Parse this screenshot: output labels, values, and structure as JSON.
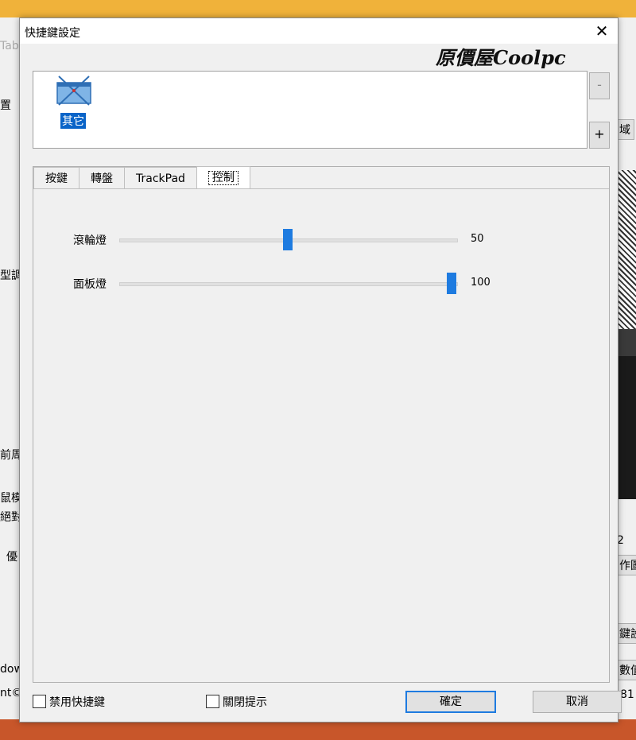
{
  "background_app": {
    "title_fragment": "Tab",
    "left_fragments": [
      "置",
      "型調",
      "前周",
      "鼠模",
      "絕對",
      "優",
      "dow",
      "nt©"
    ],
    "right_fragments": [
      "域",
      "2",
      "作圖",
      "鍵設定",
      "數值",
      "81"
    ]
  },
  "dialog": {
    "title": "快捷鍵設定",
    "close_glyph": "✕",
    "logo": "原價屋Coolpc",
    "app_icon_label": "其它",
    "remove_button": "-",
    "add_button": "+",
    "tabs": [
      {
        "label": "按鍵",
        "active": false
      },
      {
        "label": "轉盤",
        "active": false
      },
      {
        "label": "TrackPad",
        "active": false
      },
      {
        "label": "控制",
        "active": true
      }
    ],
    "sliders": [
      {
        "label": "滾輪燈",
        "value": "50",
        "percent": 50
      },
      {
        "label": "面板燈",
        "value": "100",
        "percent": 100
      }
    ],
    "disable_shortcuts_label": "禁用快捷鍵",
    "close_tips_label": "關閉提示",
    "ok_button": "確定",
    "cancel_button": "取消"
  },
  "colors": {
    "accent": "#1e7be0",
    "selection": "#0a64c8"
  }
}
